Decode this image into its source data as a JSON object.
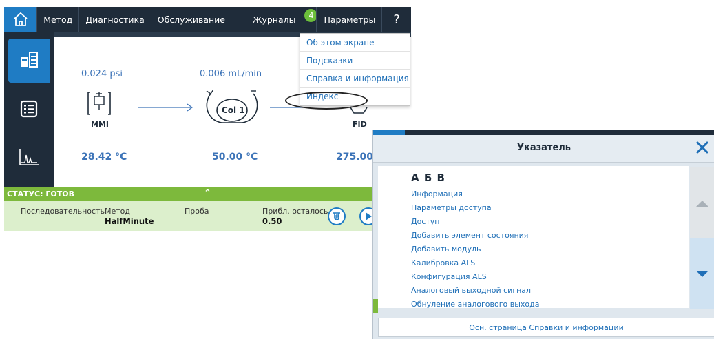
{
  "nav": {
    "items": [
      "Метод",
      "Диагностика",
      "Обслуживание",
      "Журналы",
      "Параметры",
      "?"
    ],
    "journals_badge": "4"
  },
  "flow": {
    "mmi": {
      "pressure": "0.024 psi",
      "label": "MMI",
      "temp": "28.42 °C"
    },
    "column": {
      "flow": "0.006 mL/min",
      "label": "Col 1",
      "temp": "50.00 °C"
    },
    "detector": {
      "label": "FID",
      "temp": "275.00"
    }
  },
  "status": {
    "text": "СТАТУС: ГОТОВ"
  },
  "run": {
    "sequence_label": "Последовательность",
    "method_label": "Метод",
    "method_value": "HalfMinute",
    "sample_label": "Проба",
    "remaining_label": "Прибл. осталось",
    "remaining_value": "0.50"
  },
  "menu": {
    "items": [
      "Об этом экране",
      "Подсказки",
      "Справка и информация",
      "Индекс"
    ]
  },
  "dialog": {
    "title": "Указатель",
    "letters": "А Б В",
    "entries": [
      "Информация",
      "Параметры доступа",
      "Доступ",
      "Добавить элемент состояния",
      "Добавить модуль",
      "Калибровка ALS",
      "Конфигурация ALS",
      "Аналоговый выходной сигнал",
      "Обнуление аналогового выхода"
    ],
    "footer": "Осн. страница Справки и информации"
  },
  "colors": {
    "accent": "#1f7cc4",
    "nav": "#1f2c3a",
    "status": "#7db93c",
    "link": "#1f6fb7"
  }
}
